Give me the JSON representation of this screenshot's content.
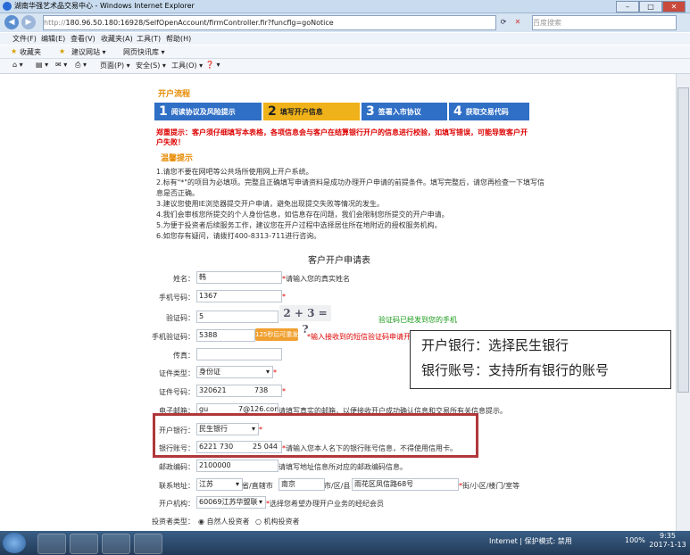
{
  "window": {
    "title": "湖南华强艺术品交易中心 - Windows Internet Explorer",
    "min": "–",
    "max": "□",
    "close": "✕"
  },
  "address": {
    "url_scheme": "http://",
    "url_rest": "180.96.50.180:16928/SelfOpenAccount/firmController.fir?funcflg=goNotice",
    "search_placeholder": "百度搜索"
  },
  "menubar": [
    "文件(F)",
    "编辑(E)",
    "查看(V)",
    "收藏夹(A)",
    "工具(T)",
    "帮助(H)"
  ],
  "favbar": {
    "fav": "收藏夹",
    "items": [
      "建议网站 ▾",
      "网页快讯库 ▾"
    ]
  },
  "cmdbar": {
    "page": "页面(P) ▾",
    "safety": "安全(S) ▾",
    "tools": "工具(O) ▾",
    "help": "❓ ▾"
  },
  "page": {
    "section_title": "开户流程",
    "steps": [
      {
        "n": "1",
        "label": "阅读协议及风险提示"
      },
      {
        "n": "2",
        "label": "填写开户信息"
      },
      {
        "n": "3",
        "label": "签署入市协议"
      },
      {
        "n": "4",
        "label": "获取交易代码"
      }
    ],
    "warning": "郑重提示：客户须仔细填写本表格，各项信息会与客户在结算银行开户的信息进行校验，如填写错误，可能导致客户开户失败！",
    "tips_title": "温馨提示",
    "tips": [
      "1.请您不要在网吧等公共场所使用网上开户系统。",
      "2.标有\"*\"的项目为必填项。完整且正确填写申请资料是成功办理开户申请的前提条件。填写完整后，请您再检查一下填写信",
      "息是否正确。",
      "3.建议您使用IE浏览器提交开户申请，避免出现提交失败等情况的发生。",
      "4.我们会审核您所提交的个人身份信息，如信息存在问题，我们会限制您所提交的开户申请。",
      "5.为便于投资者后续服务工作，建议您在开户过程中选择居住所在地附近的授权服务机构。",
      "6.如您存有疑问，请拨打400-8313-711进行咨询。"
    ],
    "form_title": "客户开户申请表",
    "fields": {
      "name": {
        "label": "姓名：",
        "value": "韩",
        "hint": "请输入您的真实姓名"
      },
      "phone": {
        "label": "手机号码：",
        "value": "1367"
      },
      "captcha": {
        "label": "验证码：",
        "value": "5",
        "image_text": "2 + 3 = ?",
        "sent": "验证码已经发到您的手机"
      },
      "sms": {
        "label": "手机验证码：",
        "value": "5388",
        "button": "125秒后可重发",
        "hint": "*输入接收到的短信验证码申请开"
      },
      "fax": {
        "label": "传真：",
        "value": ""
      },
      "idtype": {
        "label": "证件类型：",
        "value": "身份证"
      },
      "idno": {
        "label": "证件号码：",
        "value1": "320621",
        "value2": "738"
      },
      "email": {
        "label": "电子邮箱：",
        "value1": "gu",
        "value2": "7@126.com",
        "hint": "请填写真实的邮箱，以便接收开户成功确认信息和交易所有关信息提示。"
      },
      "bank": {
        "label": "开户银行：",
        "value": "民生银行"
      },
      "account": {
        "label": "银行账号：",
        "value1": "6221 730",
        "value2": "25 044",
        "hint": "请输入您本人名下的银行账号信息，不得使用信用卡。"
      },
      "zip": {
        "label": "邮政编码：",
        "value": "2100000",
        "hint": "请填写地址信息所对应的邮政编码信息。"
      },
      "addr": {
        "label": "联系地址：",
        "province": "江苏",
        "prov_suffix": "省/直辖市",
        "city": "南京",
        "city_suffix": "市/区/县",
        "street": "雨花区凤信路68号",
        "tail": "街/小区/楼门/室等"
      },
      "org": {
        "label": "开户机构：",
        "value": "60069江苏华盟联",
        "hint": "选择您希望办理开户业务的经纪会员"
      },
      "investor": {
        "label": "投资者类型：",
        "opt1": "自然人投资者",
        "opt2": "机构投资者"
      }
    },
    "callout": [
      "开户银行：选择民生银行",
      "银行账号：支持所有银行的账号"
    ]
  },
  "status": {
    "zone": "Internet | 保护模式: 禁用",
    "zoom": "100%"
  },
  "clock": {
    "time": "9:35",
    "date": "2017-1-13"
  }
}
